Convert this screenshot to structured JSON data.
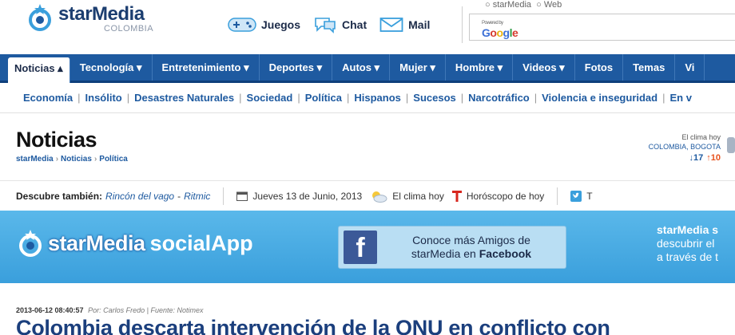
{
  "brand": {
    "name": "starMedia",
    "country": "COLOMBIA",
    "primary_color": "#1e5aa0",
    "banner_color": "#3a9fdc"
  },
  "toplinks": [
    {
      "label": "Juegos",
      "icon": "gamepad-icon"
    },
    {
      "label": "Chat",
      "icon": "chat-bubble-icon"
    },
    {
      "label": "Mail",
      "icon": "envelope-icon"
    }
  ],
  "search": {
    "scope_options": [
      "starMedia",
      "Web"
    ],
    "powered_by": "Powered by",
    "provider": "Google",
    "value": ""
  },
  "mainnav": [
    {
      "label": "Noticias ▴",
      "active": true
    },
    {
      "label": "Tecnología ▾"
    },
    {
      "label": "Entretenimiento ▾"
    },
    {
      "label": "Deportes ▾"
    },
    {
      "label": "Autos ▾"
    },
    {
      "label": "Mujer ▾"
    },
    {
      "label": "Hombre ▾"
    },
    {
      "label": "Videos ▾"
    },
    {
      "label": "Fotos"
    },
    {
      "label": "Temas"
    },
    {
      "label": "Vi"
    }
  ],
  "subnav": [
    "Economía",
    "Insólito",
    "Desastres Naturales",
    "Sociedad",
    "Política",
    "Hispanos",
    "Sucesos",
    "Narcotráfico",
    "Violencia e inseguridad",
    "En v"
  ],
  "section": {
    "title": "Noticias",
    "breadcrumb": [
      "starMedia",
      "Noticias",
      "Política"
    ]
  },
  "weather": {
    "label": "El clima hoy",
    "location": "COLOMBIA, BOGOTA",
    "low": "↓17",
    "high": "↑10"
  },
  "discover": {
    "label": "Descubre también:",
    "links": [
      "Rincón del vago",
      "Ritmic"
    ],
    "separator": "-",
    "date": "Jueves 13 de Junio, 2013",
    "weather_link": "El clima hoy",
    "horoscope_link": "Horóscopo de hoy",
    "twitter_initial": "T"
  },
  "banner": {
    "name": "starMedia",
    "app": "socialApp",
    "fb_line1": "Conoce más Amigos de",
    "fb_line2_prefix": "starMedia en ",
    "fb_line2_bold": "Facebook",
    "fb_icon": "f",
    "right_line1": "starMedia s",
    "right_line2": "descubrir el",
    "right_line3": "a través de t"
  },
  "article": {
    "datetime": "2013-06-12 08:40:57",
    "byline": "Por: Carlos Fredo | Fuente: Notimex",
    "headline": "Colombia descarta intervención de la ONU en conflicto con"
  }
}
